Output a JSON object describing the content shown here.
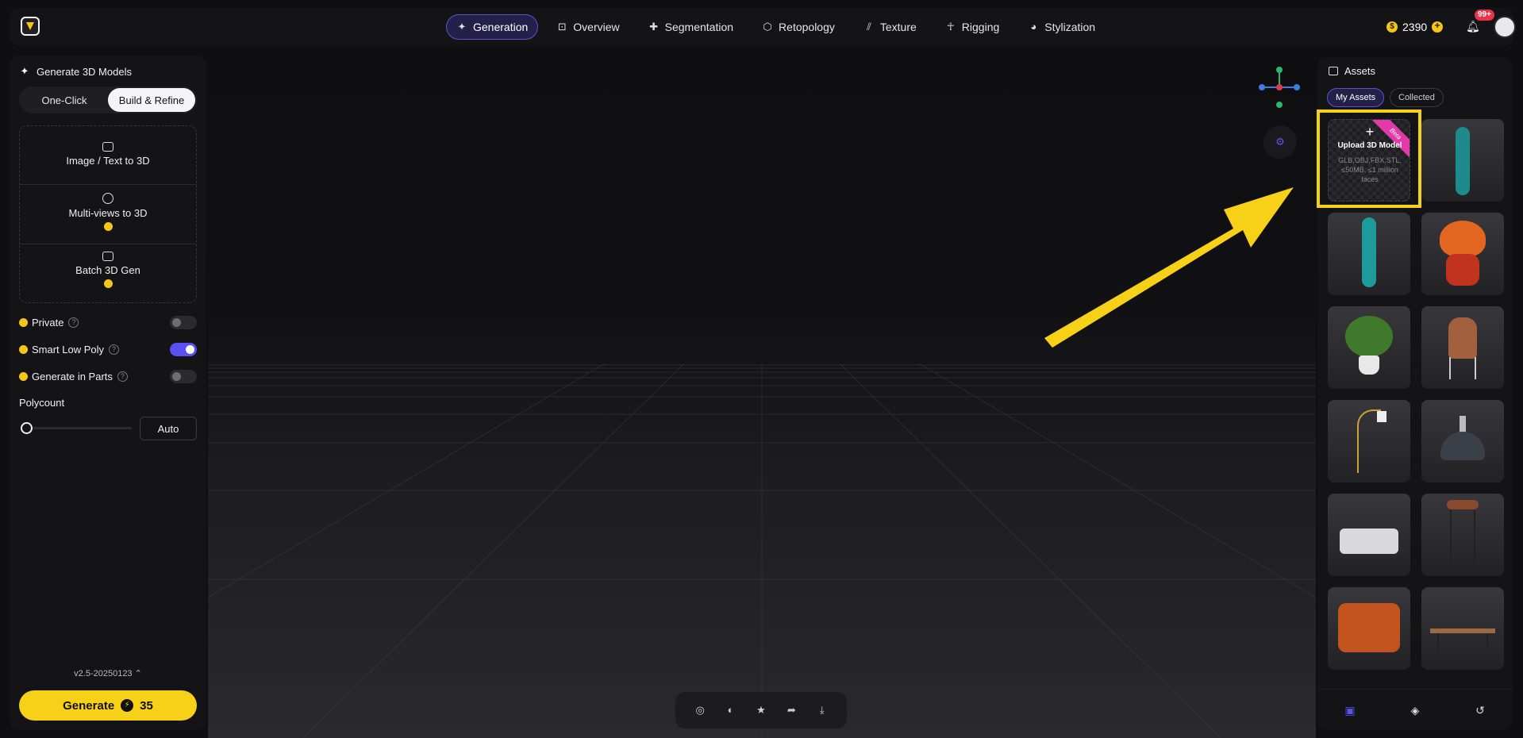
{
  "nav": {
    "items": [
      {
        "label": "Generation",
        "icon": "sparkle-icon",
        "active": true
      },
      {
        "label": "Overview",
        "icon": "scan-icon",
        "active": false
      },
      {
        "label": "Segmentation",
        "icon": "puzzle-icon",
        "active": false
      },
      {
        "label": "Retopology",
        "icon": "mesh-icon",
        "active": false
      },
      {
        "label": "Texture",
        "icon": "stripes-icon",
        "active": false
      },
      {
        "label": "Rigging",
        "icon": "figure-icon",
        "active": false
      },
      {
        "label": "Stylization",
        "icon": "palette-icon",
        "active": false
      }
    ]
  },
  "header": {
    "credits": "2390",
    "notifications_badge": "99+"
  },
  "left": {
    "title": "Generate 3D Models",
    "segments": {
      "one_click": "One-Click",
      "build_refine": "Build & Refine"
    },
    "modes": {
      "image_text": "Image / Text to 3D",
      "multi_views": "Multi-views to 3D",
      "batch": "Batch 3D Gen"
    },
    "options": {
      "private": "Private",
      "smart_low_poly": "Smart Low Poly",
      "generate_in_parts": "Generate in Parts"
    },
    "polycount_label": "Polycount",
    "polycount_value": "Auto",
    "version": "v2.5-20250123",
    "generate_label": "Generate",
    "generate_cost": "35"
  },
  "assets": {
    "title": "Assets",
    "tabs": {
      "my": "My Assets",
      "collected": "Collected"
    },
    "upload": {
      "plus": "+",
      "title": "Upload 3D Model",
      "subtitle": "GLB,OBJ,FBX,STL, ≤50MB, ≤1 million faces",
      "ribbon": "Beta"
    }
  },
  "colors": {
    "accent": "#5a4ff0",
    "brand_yellow": "#f7d117",
    "badge_red": "#e9334a"
  }
}
